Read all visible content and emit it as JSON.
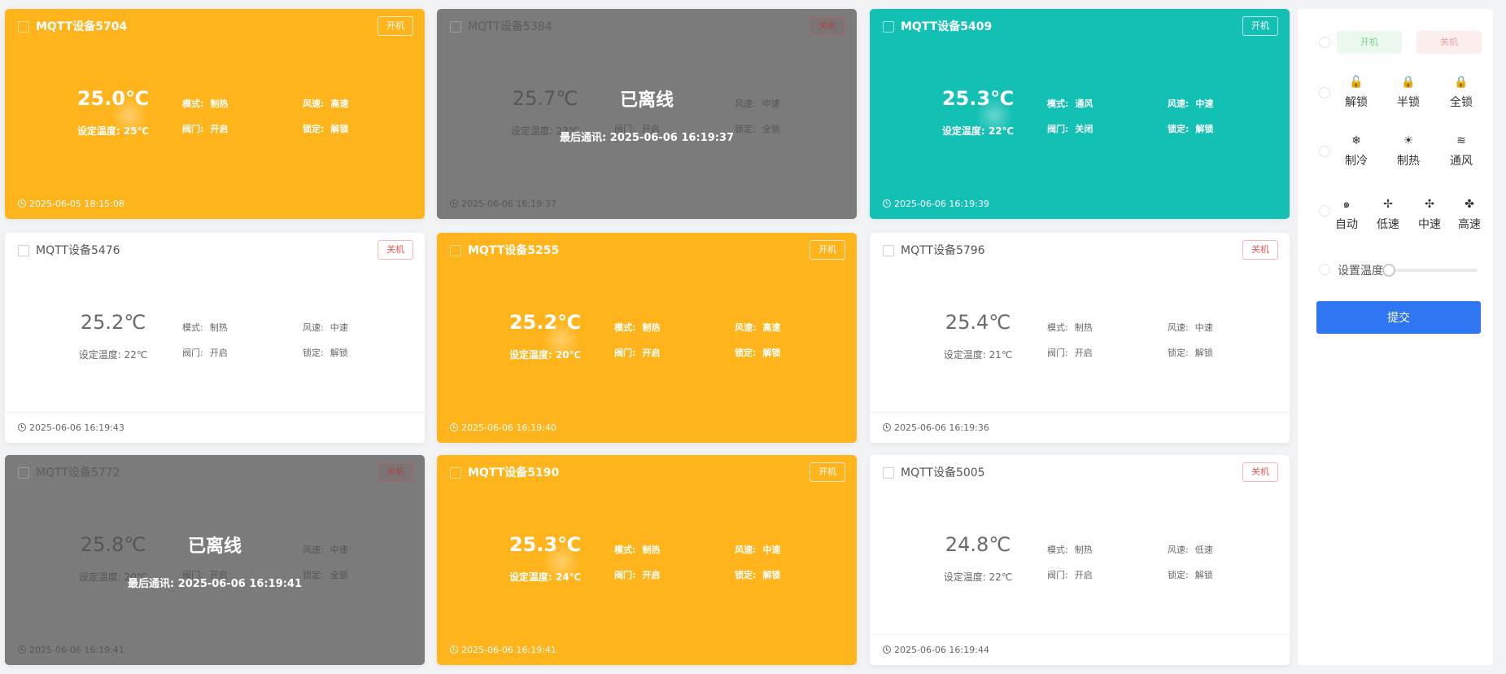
{
  "devices": [
    {
      "name": "MQTT设备5704",
      "power": "开机",
      "temp": "25.0℃",
      "set_temp": "设定温度: 25℃",
      "mode_k": "模式:",
      "mode_v": "制热",
      "fan_k": "风速:",
      "fan_v": "高速",
      "valve_k": "阀门:",
      "valve_v": "开启",
      "lock_k": "锁定:",
      "lock_v": "解锁",
      "time": "2025-06-05 18:15:08"
    },
    {
      "name": "MQTT设备5384",
      "power": "关机",
      "temp": "25.7℃",
      "set_temp": "设定温度: 23℃",
      "mode_k": "模式:",
      "mode_v": "制热",
      "fan_k": "风速:",
      "fan_v": "中速",
      "valve_k": "阀门:",
      "valve_v": "开启",
      "lock_k": "锁定:",
      "lock_v": "全锁",
      "time": "2025-06-06 16:19:37",
      "offline": "已离线",
      "last_comm": "最后通讯: 2025-06-06 16:19:37"
    },
    {
      "name": "MQTT设备5409",
      "power": "开机",
      "temp": "25.3℃",
      "set_temp": "设定温度: 22℃",
      "mode_k": "模式:",
      "mode_v": "通风",
      "fan_k": "风速:",
      "fan_v": "中速",
      "valve_k": "阀门:",
      "valve_v": "关闭",
      "lock_k": "锁定:",
      "lock_v": "解锁",
      "time": "2025-06-06 16:19:39"
    },
    {
      "name": "MQTT设备5476",
      "power": "关机",
      "temp": "25.2℃",
      "set_temp": "设定温度: 22℃",
      "mode_k": "模式:",
      "mode_v": "制热",
      "fan_k": "风速:",
      "fan_v": "中速",
      "valve_k": "阀门:",
      "valve_v": "开启",
      "lock_k": "锁定:",
      "lock_v": "解锁",
      "time": "2025-06-06 16:19:43"
    },
    {
      "name": "MQTT设备5255",
      "power": "开机",
      "temp": "25.2℃",
      "set_temp": "设定温度: 20℃",
      "mode_k": "模式:",
      "mode_v": "制热",
      "fan_k": "风速:",
      "fan_v": "高速",
      "valve_k": "阀门:",
      "valve_v": "开启",
      "lock_k": "锁定:",
      "lock_v": "解锁",
      "time": "2025-06-06 16:19:40"
    },
    {
      "name": "MQTT设备5796",
      "power": "关机",
      "temp": "25.4℃",
      "set_temp": "设定温度: 21℃",
      "mode_k": "模式:",
      "mode_v": "制热",
      "fan_k": "风速:",
      "fan_v": "中速",
      "valve_k": "阀门:",
      "valve_v": "开启",
      "lock_k": "锁定:",
      "lock_v": "解锁",
      "time": "2025-06-06 16:19:36"
    },
    {
      "name": "MQTT设备5772",
      "power": "关机",
      "temp": "25.8℃",
      "set_temp": "设定温度: 20℃",
      "mode_k": "模式:",
      "mode_v": "制热",
      "fan_k": "风速:",
      "fan_v": "中速",
      "valve_k": "阀门:",
      "valve_v": "开启",
      "lock_k": "锁定:",
      "lock_v": "全锁",
      "time": "2025-06-06 16:19:41",
      "offline": "已离线",
      "last_comm": "最后通讯: 2025-06-06 16:19:41"
    },
    {
      "name": "MQTT设备5190",
      "power": "开机",
      "temp": "25.3℃",
      "set_temp": "设定温度: 24℃",
      "mode_k": "模式:",
      "mode_v": "制热",
      "fan_k": "风速:",
      "fan_v": "中速",
      "valve_k": "阀门:",
      "valve_v": "开启",
      "lock_k": "锁定:",
      "lock_v": "解锁",
      "time": "2025-06-06 16:19:41"
    },
    {
      "name": "MQTT设备5005",
      "power": "关机",
      "temp": "24.8℃",
      "set_temp": "设定温度: 22℃",
      "mode_k": "模式:",
      "mode_v": "制热",
      "fan_k": "风速:",
      "fan_v": "低速",
      "valve_k": "阀门:",
      "valve_v": "开启",
      "lock_k": "锁定:",
      "lock_v": "解锁",
      "time": "2025-06-06 16:19:44"
    }
  ],
  "colors": {
    "orange": "#ffb41b",
    "teal": "#13c0b4",
    "offline_gray": "#7b7b7b",
    "submit_blue": "#2f76f2"
  },
  "panel": {
    "power_on": "开机",
    "power_off": "关机",
    "lock": [
      {
        "icon": "🔓",
        "label": "解锁"
      },
      {
        "icon": "🔒",
        "label": "半锁"
      },
      {
        "icon": "🔒",
        "label": "全锁"
      }
    ],
    "mode": [
      {
        "icon": "❄",
        "label": "制冷"
      },
      {
        "icon": "☀",
        "label": "制热"
      },
      {
        "icon": "≋",
        "label": "通风"
      }
    ],
    "fan": [
      {
        "icon": "๑",
        "label": "自动"
      },
      {
        "icon": "✢",
        "label": "低速"
      },
      {
        "icon": "✣",
        "label": "中速"
      },
      {
        "icon": "✤",
        "label": "高速"
      }
    ],
    "temp_label": "设置温度:",
    "temp_level": 0,
    "submit": "提交"
  }
}
